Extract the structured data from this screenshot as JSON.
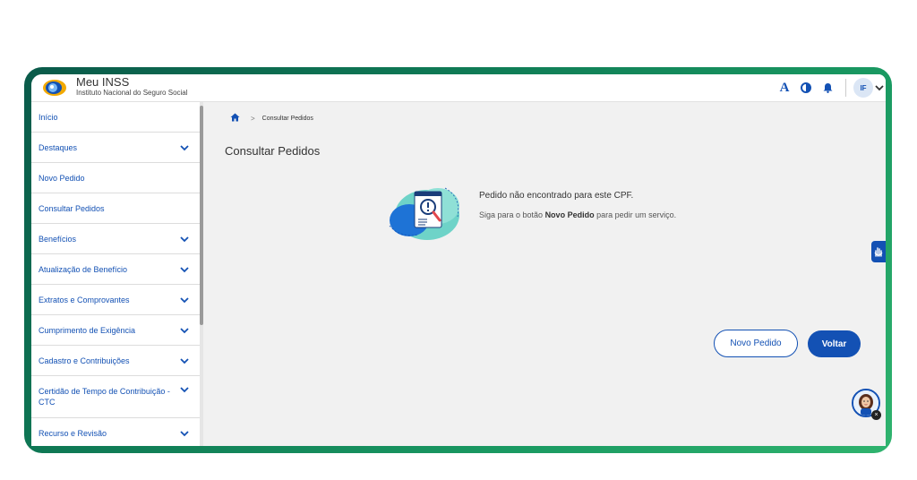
{
  "app": {
    "title": "Meu INSS",
    "subtitle": "Instituto Nacional do Seguro Social",
    "brand_color": "#1351b4"
  },
  "topbar": {
    "font_size_label": "A",
    "contrast_icon": "contrast-icon",
    "notifications_icon": "bell-icon",
    "avatar_initials": "IF",
    "account_menu_icon": "chevron-down-icon"
  },
  "sidebar": {
    "items": [
      {
        "label": "Início",
        "expandable": false
      },
      {
        "label": "Destaques",
        "expandable": true
      },
      {
        "label": "Novo Pedido",
        "expandable": false
      },
      {
        "label": "Consultar Pedidos",
        "expandable": false
      },
      {
        "label": "Benefícios",
        "expandable": true
      },
      {
        "label": "Atualização de Benefício",
        "expandable": true
      },
      {
        "label": "Extratos e Comprovantes",
        "expandable": true
      },
      {
        "label": "Cumprimento de Exigência",
        "expandable": true
      },
      {
        "label": "Cadastro e Contribuições",
        "expandable": true
      },
      {
        "label": "Certidão de Tempo de Contribuição - CTC",
        "expandable": true
      },
      {
        "label": "Recurso e Revisão",
        "expandable": true
      }
    ]
  },
  "breadcrumb": {
    "home_icon": "home-icon",
    "separator": ">",
    "current": "Consultar Pedidos"
  },
  "main": {
    "title": "Consultar Pedidos",
    "empty_message": "Pedido não encontrado para este CPF.",
    "hint_prefix": "Siga para o botão ",
    "hint_bold": "Novo Pedido",
    "hint_suffix": " para pedir um serviço.",
    "new_request_button": "Novo Pedido",
    "back_button": "Voltar"
  },
  "widgets": {
    "vlibras_icon": "sign-language-icon",
    "assistant_icon": "virtual-assistant-avatar",
    "assistant_close": "×"
  }
}
